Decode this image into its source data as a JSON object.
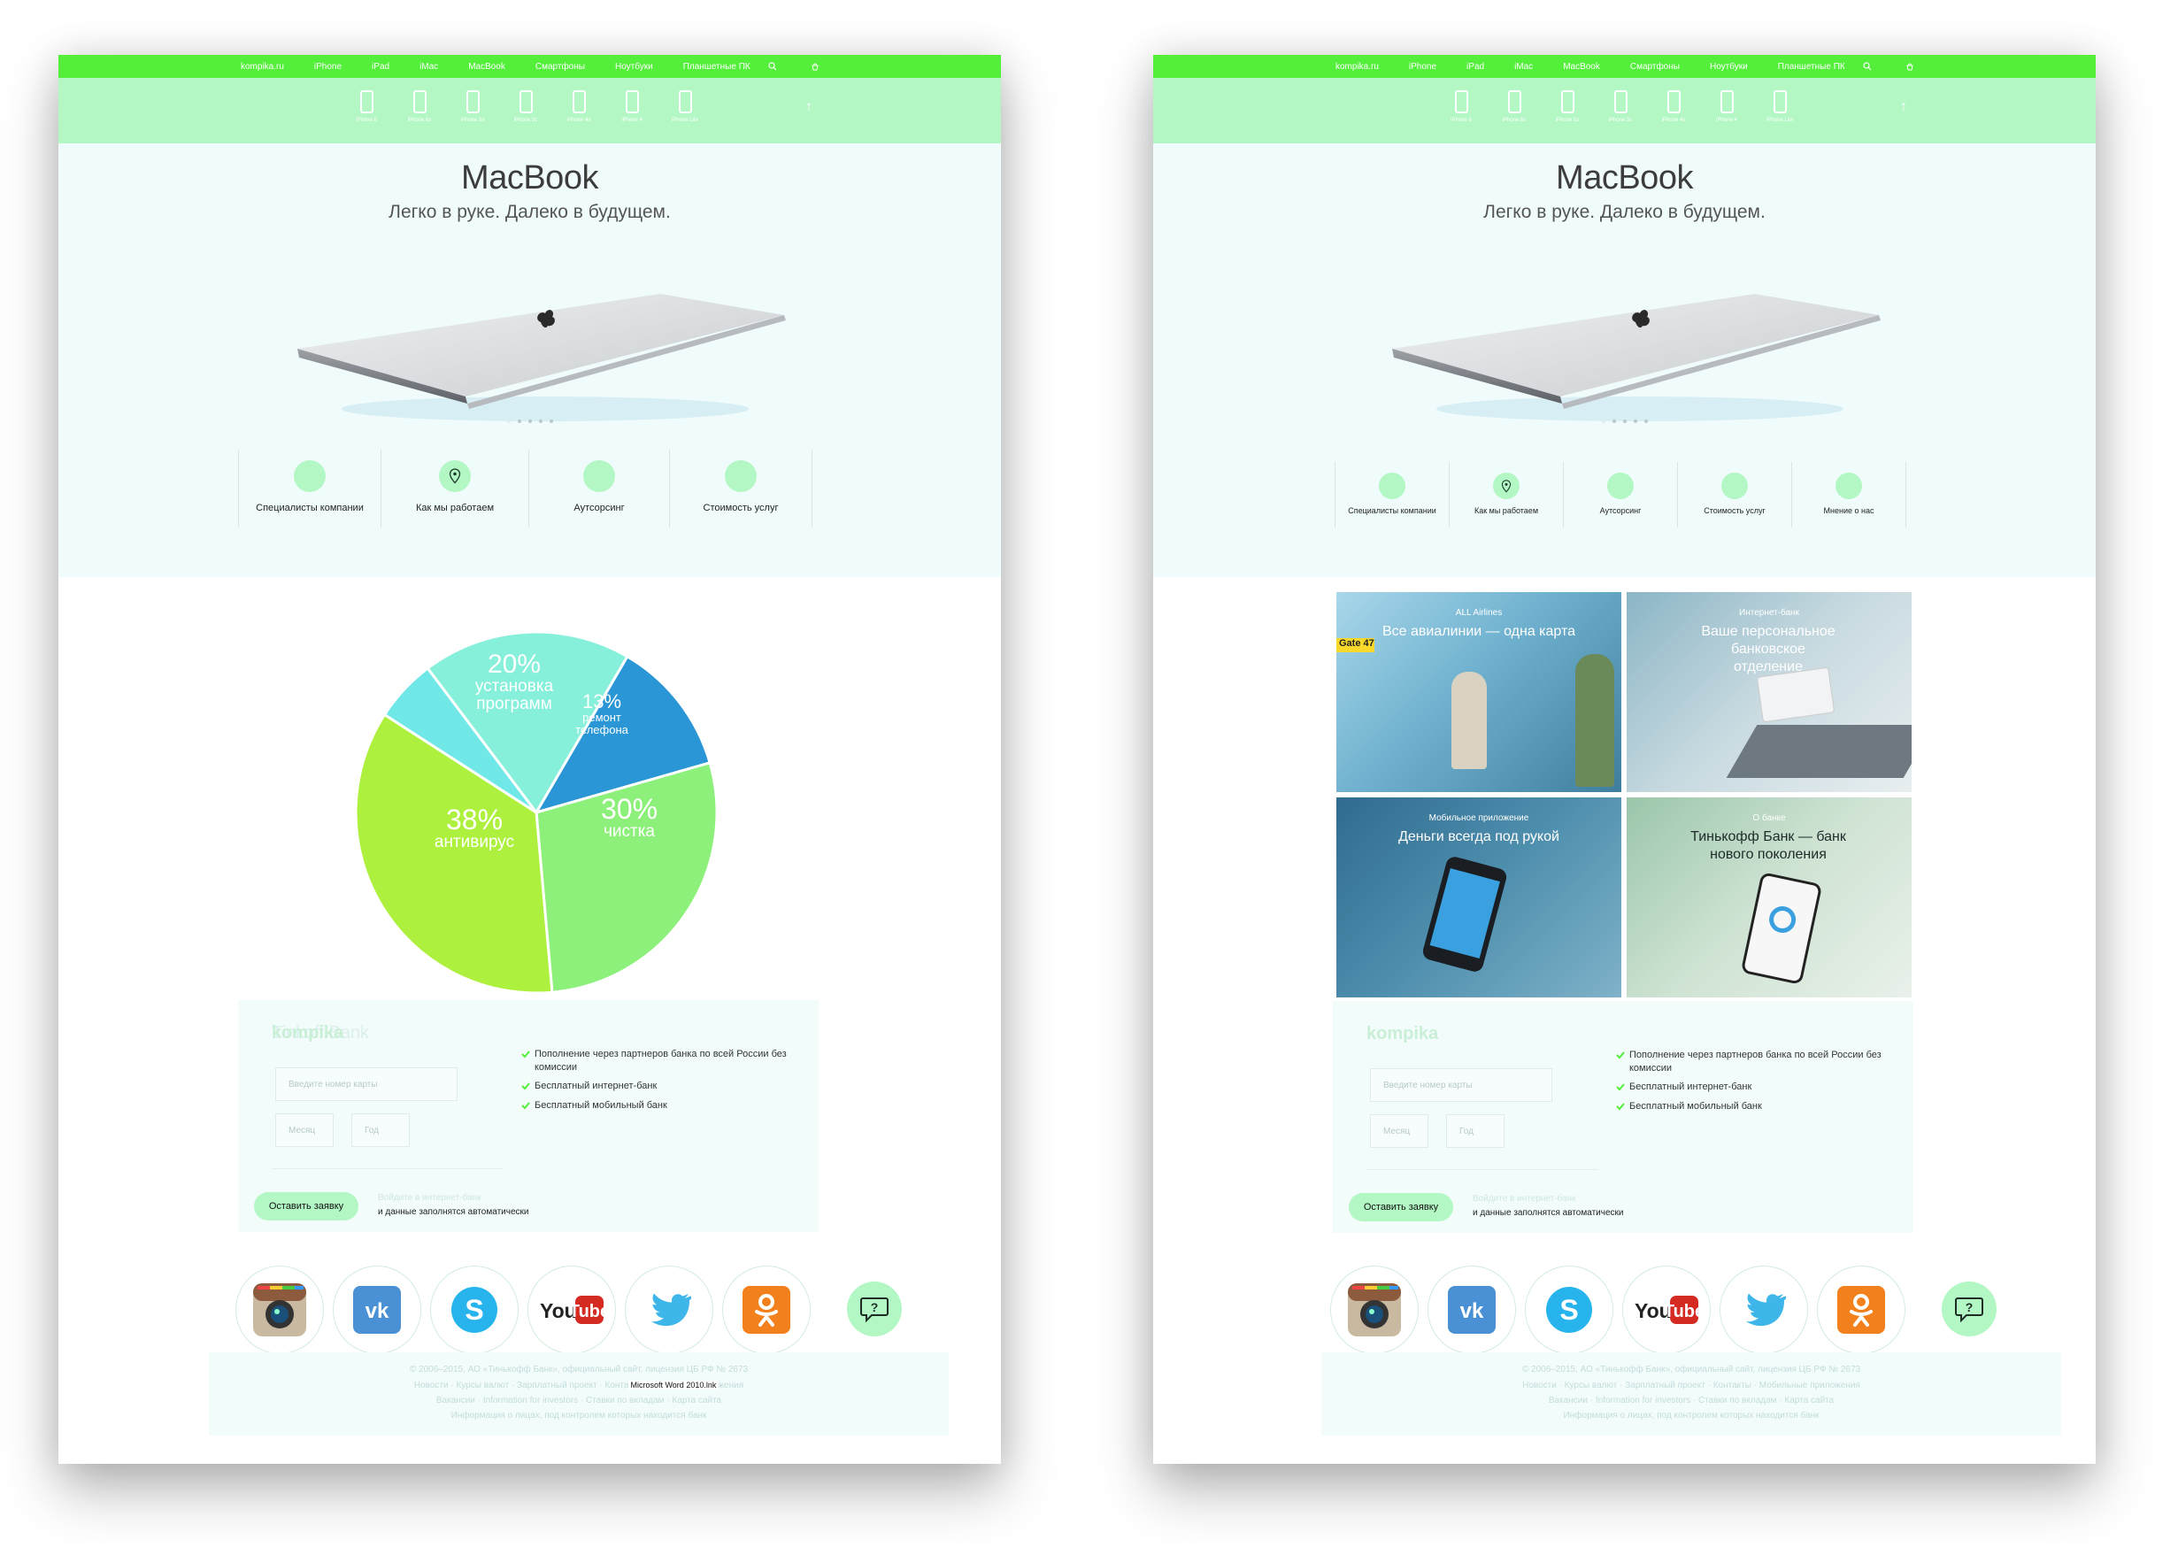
{
  "nav": {
    "site": "kompika.ru",
    "items": [
      "iPhone",
      "iPad",
      "iMac",
      "MacBook",
      "Смартфоны",
      "Ноутбуки",
      "Планшетные ПК"
    ]
  },
  "subnav": {
    "devices": [
      "iPhone 6",
      "iPhone 6s",
      "iPhone 5s",
      "iPhone 5c",
      "iPhone 4s",
      "iPhone 4",
      "iPhone Lite"
    ]
  },
  "hero": {
    "title": "MacBook",
    "subtitle": "Легко в руке. Далеко в будущем."
  },
  "services_left": [
    "Специалисты компании",
    "Как мы работаем",
    "Аутсорсинг",
    "Стоимость услуг"
  ],
  "services_right": [
    "Специалисты компании",
    "Как мы работаем",
    "Аутсорсинг",
    "Стоимость услуг",
    "Мнение о нас"
  ],
  "chart_data": {
    "type": "pie",
    "slices": [
      {
        "label": "установка программ",
        "value": 20,
        "color": "#86f0da"
      },
      {
        "label": "ремонт телефона",
        "value": 13,
        "color": "#2b96d6"
      },
      {
        "label": "чистка",
        "value": 30,
        "color": "#8df07a"
      },
      {
        "label": "антивирус",
        "value": 38,
        "color": "#aef03e"
      },
      {
        "label": "",
        "value": 6,
        "color": "#70e8e8"
      }
    ],
    "labels_text": {
      "p20": "20%",
      "p13": "13%",
      "p30": "30%",
      "p38": "38%",
      "l20": "установка программ",
      "l13": "ремонт телефона",
      "l30": "чистка",
      "l38": "антивирус"
    }
  },
  "tiles": [
    {
      "caption": "ALL Airlines",
      "title": "Все авиалинии — одна карта",
      "sign": "Gate 47"
    },
    {
      "caption": "Интернет-банк",
      "title": "Ваше персональное банковское отделение"
    },
    {
      "caption": "Мобильное приложение",
      "title": "Деньги всегда под рукой"
    },
    {
      "caption": "О банке",
      "title": "Тинькофф Банк — банк нового поколения"
    }
  ],
  "form_left": {
    "brand": "Tinkoff Bank",
    "brand_overlay": "kompika",
    "card_placeholder": "Введите номер карты",
    "month_placeholder": "Месяц",
    "year_placeholder": "Год",
    "submit": "Оставить заявку",
    "aux1": "Войдите в интернет-банк",
    "aux2": "и данные заполнятся автоматически",
    "features": [
      "Пополнение через партнеров банка по всей России без комиссии",
      "Бесплатный интернет-банк",
      "Бесплатный мобильный банк"
    ]
  },
  "form_right": {
    "brand": "kompika",
    "card_placeholder": "Введите номер карты",
    "month_placeholder": "Месяц",
    "year_placeholder": "Год",
    "submit": "Оставить заявку",
    "aux1": "Войдите в интернет-банк",
    "aux2": "и данные заполнятся автоматически",
    "features": [
      "Пополнение через партнеров банка по всей России без комиссии",
      "Бесплатный интернет-банк",
      "Бесплатный мобильный банк"
    ]
  },
  "social": [
    "instagram-icon",
    "vk-icon",
    "skype-icon",
    "youtube-icon",
    "twitter-icon",
    "odnoklassniki-icon"
  ],
  "footer": {
    "copyright": "© 2006–2015, АО «Тинькофф Банк», официальный сайт, лицензия ЦБ РФ № 2673",
    "links1": "Новости · Курсы валют · Зарплатный проект · Контакты · Мобильные приложения",
    "links1_left_a": "Новости · Курсы валют · Зарплатный проект · Конта",
    "tooltip": "Microsoft Word 2010.lnk",
    "links1_left_b": "жения",
    "links2": "Вакансии · Information for investors · Ставки по вкладам · Карта сайта",
    "links3": "Информация о лицах, под контролем которых находится банк"
  },
  "colors": {
    "green": "#54ef3b",
    "mint": "#b2f7c4",
    "hero_bg": "#f0fcfb"
  }
}
